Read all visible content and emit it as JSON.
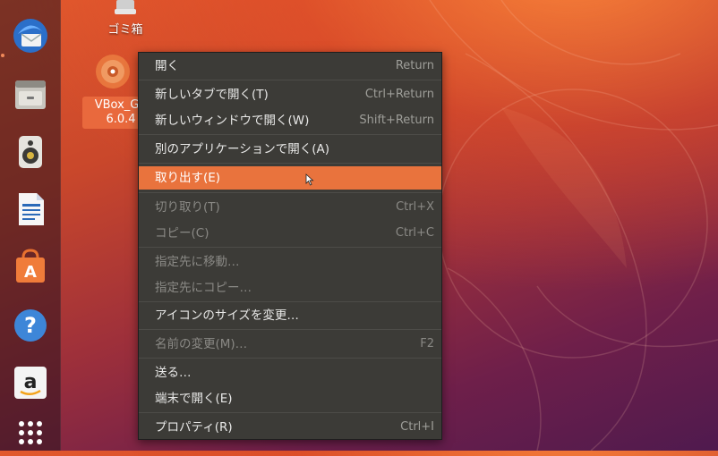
{
  "desktop": {
    "trash_label": "ゴミ箱",
    "vbox_label_line1": "VBox_GA",
    "vbox_label_line2": "6.0.4"
  },
  "dock": {
    "items": [
      {
        "name": "thunderbird-icon"
      },
      {
        "name": "files-icon"
      },
      {
        "name": "rhythmbox-icon"
      },
      {
        "name": "libreoffice-writer-icon"
      },
      {
        "name": "software-center-icon"
      },
      {
        "name": "help-icon"
      },
      {
        "name": "amazon-icon"
      },
      {
        "name": "show-applications-icon"
      }
    ]
  },
  "context_menu": {
    "items": [
      {
        "label": "開く",
        "accel": "Return"
      },
      {
        "label": "新しいタブで開く(T)",
        "accel": "Ctrl+Return"
      },
      {
        "label": "新しいウィンドウで開く(W)",
        "accel": "Shift+Return"
      },
      {
        "label": "別のアプリケーションで開く(A)",
        "accel": ""
      },
      {
        "label": "取り出す(E)",
        "accel": ""
      },
      {
        "label": "切り取り(T)",
        "accel": "Ctrl+X"
      },
      {
        "label": "コピー(C)",
        "accel": "Ctrl+C"
      },
      {
        "label": "指定先に移動…",
        "accel": ""
      },
      {
        "label": "指定先にコピー…",
        "accel": ""
      },
      {
        "label": "アイコンのサイズを変更…",
        "accel": ""
      },
      {
        "label": "名前の変更(M)…",
        "accel": "F2"
      },
      {
        "label": "送る…",
        "accel": ""
      },
      {
        "label": "端末で開く(E)",
        "accel": ""
      },
      {
        "label": "プロパティ(R)",
        "accel": "Ctrl+I"
      }
    ]
  },
  "colors": {
    "highlight": "#e9733d",
    "menu_bg": "#3c3b37"
  }
}
